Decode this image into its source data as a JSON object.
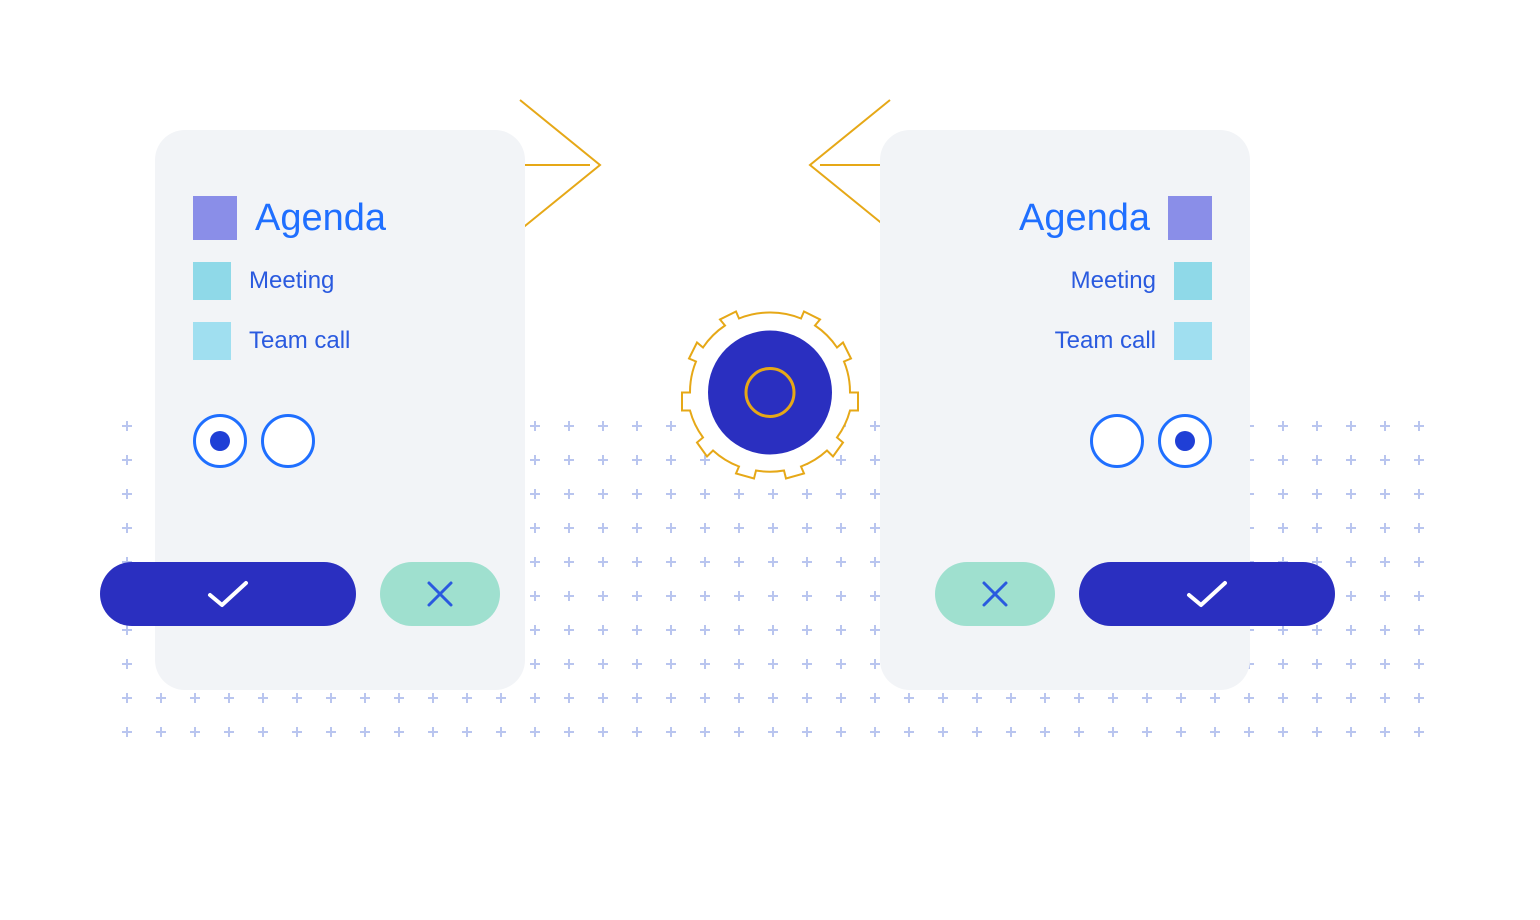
{
  "colors": {
    "accent_blue": "#1f6fff",
    "deep_blue": "#2a2fc0",
    "purple_sq": "#8a8ee8",
    "cyan_sq": "#8fd9e8",
    "mint": "#9fe0cf",
    "gold": "#e6a817"
  },
  "left_card": {
    "title": "Agenda",
    "items": [
      "Meeting",
      "Team call"
    ],
    "radio_selected_index": 0,
    "primary_action": "confirm",
    "secondary_action": "cancel",
    "button_order": [
      "primary",
      "secondary"
    ]
  },
  "right_card": {
    "title": "Agenda",
    "items": [
      "Meeting",
      "Team call"
    ],
    "radio_selected_index": 1,
    "primary_action": "confirm",
    "secondary_action": "cancel",
    "button_order": [
      "secondary",
      "primary"
    ]
  },
  "center": {
    "icon": "gear"
  },
  "arrows": {
    "left_direction": "right",
    "right_direction": "left"
  }
}
